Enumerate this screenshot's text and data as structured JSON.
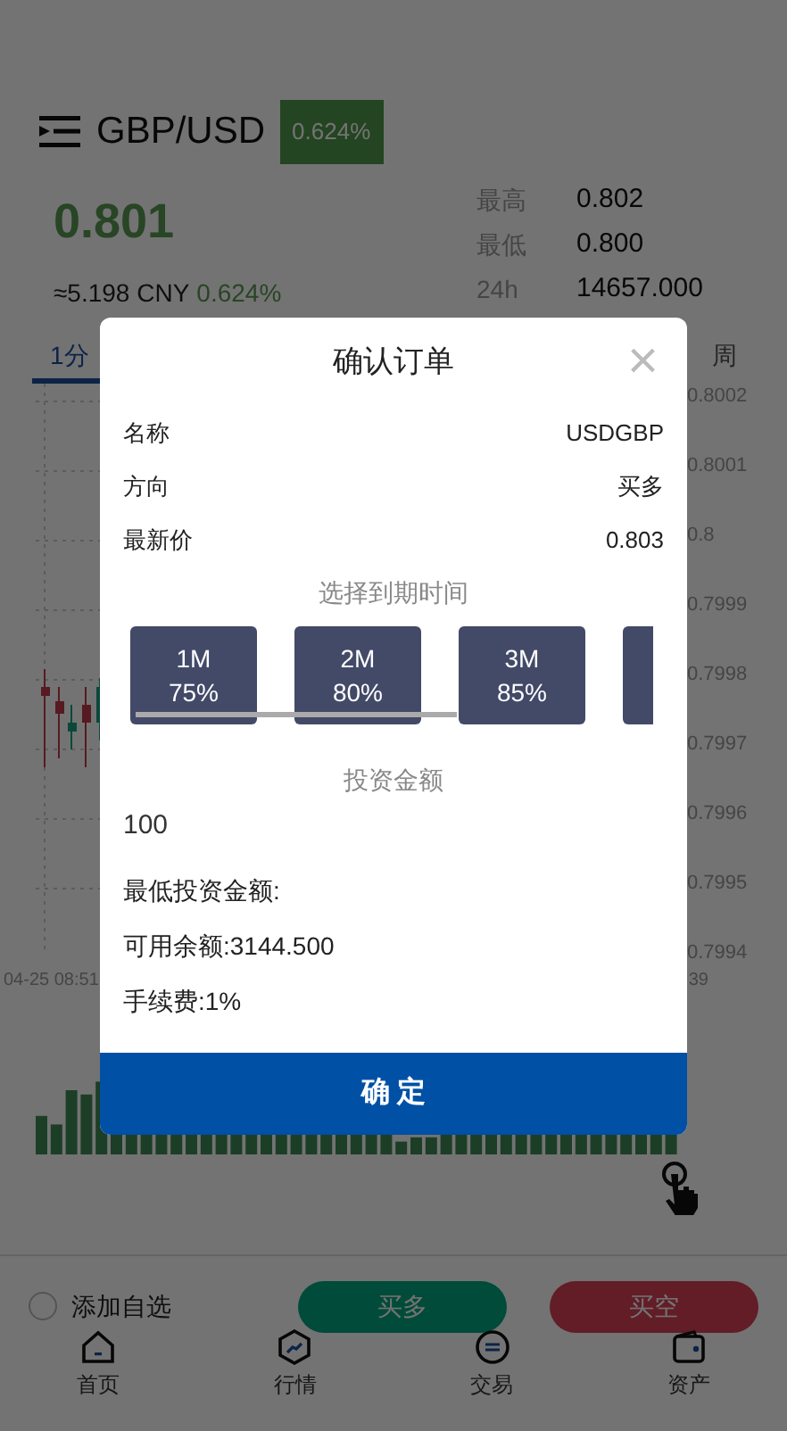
{
  "header": {
    "symbol": "GBP/USD",
    "change_badge": "0.624%"
  },
  "quote": {
    "price": "0.801",
    "cny": "≈5.198 CNY",
    "change": "0.624%",
    "stats": [
      {
        "label": "最高",
        "value": "0.802"
      },
      {
        "label": "最低",
        "value": "0.800"
      },
      {
        "label": "24h",
        "value": "14657.000"
      }
    ]
  },
  "tabs": [
    {
      "label": "1分",
      "selected": true
    },
    {
      "label": "周",
      "selected": false
    }
  ],
  "chart": {
    "y_labels": [
      "0.8002",
      "0.8001",
      "0.8",
      "0.7999",
      "0.7998",
      "0.7997",
      "0.7996",
      "0.7995",
      "0.7994"
    ],
    "x_labels": [
      "04-25 08:51",
      "39"
    ]
  },
  "action_bar": {
    "favorite": {
      "label": "添加自选",
      "checked": false
    },
    "buy": "买多",
    "sell": "买空"
  },
  "nav": [
    {
      "label": "首页",
      "kind": "home"
    },
    {
      "label": "行情",
      "kind": "market"
    },
    {
      "label": "交易",
      "kind": "trade"
    },
    {
      "label": "资产",
      "kind": "wallet"
    }
  ],
  "dialog": {
    "title": "确认订单",
    "close": "×",
    "rows": [
      {
        "label": "名称",
        "value": "USDGBP"
      },
      {
        "label": "方向",
        "value": "买多"
      },
      {
        "label": "最新价",
        "value": "0.803"
      }
    ],
    "period_heading": "选择到期时间",
    "periods": [
      {
        "time": "1M",
        "rate": "75%"
      },
      {
        "time": "2M",
        "rate": "80%"
      },
      {
        "time": "3M",
        "rate": "85%"
      }
    ],
    "amount_heading": "投资金额",
    "amount": "100",
    "notes": [
      "最低投资金额:",
      "可用余额:3144.500",
      "手续费:1%"
    ],
    "confirm": "确 定"
  }
}
